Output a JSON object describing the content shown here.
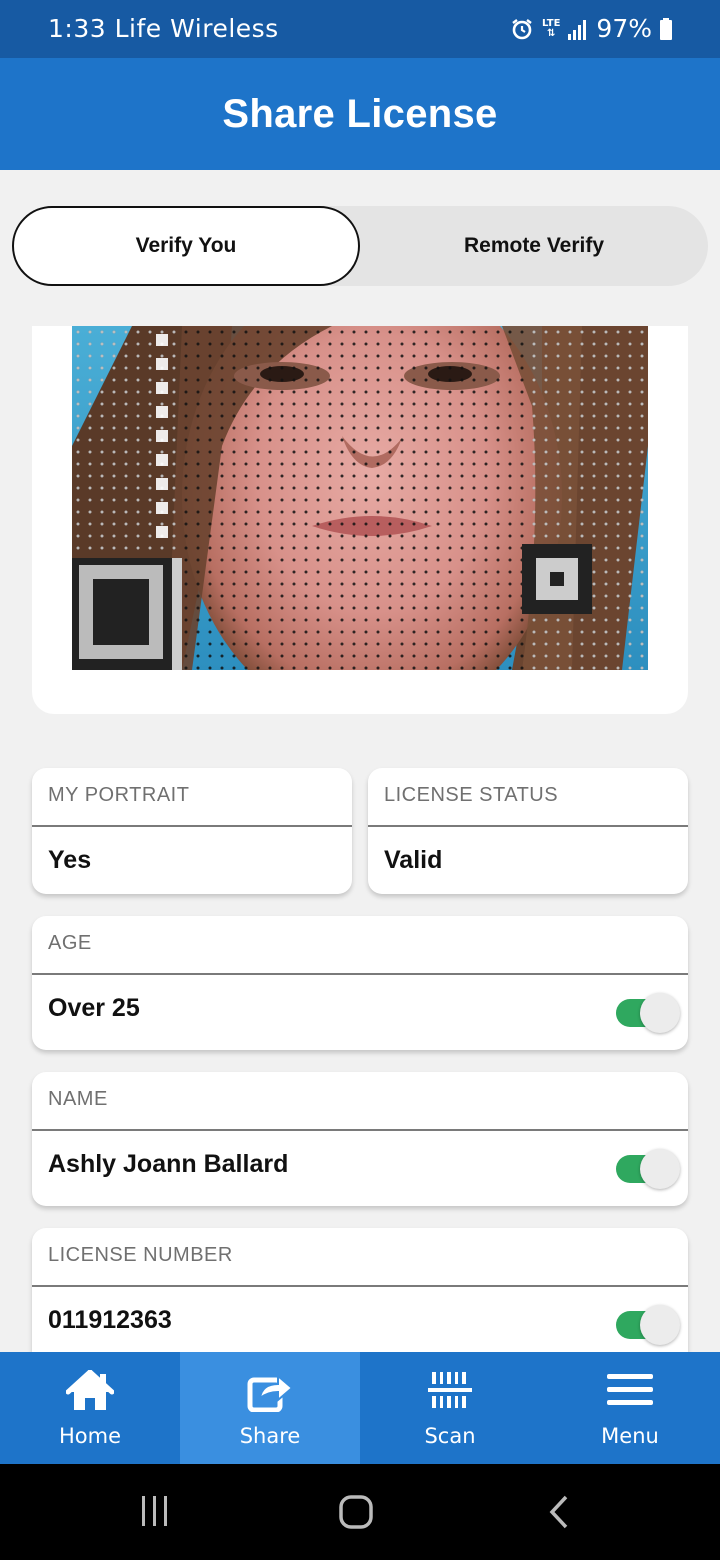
{
  "status_bar": {
    "time": "1:33",
    "carrier": "Life Wireless",
    "network": "LTE",
    "battery": "97%",
    "icons": [
      "alarm-icon",
      "lte-icon",
      "signal-icon",
      "battery-icon"
    ]
  },
  "header": {
    "title": "Share License"
  },
  "segment": {
    "tabs": [
      {
        "label": "Verify You",
        "selected": true
      },
      {
        "label": "Remote Verify",
        "selected": false
      }
    ]
  },
  "fields": {
    "portrait": {
      "label": "MY PORTRAIT",
      "value": "Yes"
    },
    "license_status": {
      "label": "LICENSE STATUS",
      "value": "Valid"
    },
    "age": {
      "label": "AGE",
      "value": "Over 25",
      "shared": true
    },
    "name": {
      "label": "NAME",
      "value": "Ashly Joann Ballard",
      "shared": true
    },
    "license_number": {
      "label": "LICENSE NUMBER",
      "value": "011912363",
      "shared": true
    }
  },
  "bottom_nav": {
    "items": [
      {
        "label": "Home",
        "icon": "home-icon",
        "active": false
      },
      {
        "label": "Share",
        "icon": "share-icon",
        "active": true
      },
      {
        "label": "Scan",
        "icon": "barcode-scan-icon",
        "active": false
      },
      {
        "label": "Menu",
        "icon": "hamburger-menu-icon",
        "active": false
      }
    ]
  },
  "system_nav": {
    "icons": [
      "recent-apps-icon",
      "home-circle-icon",
      "back-icon"
    ]
  },
  "colors": {
    "status_bar": "#175aa3",
    "primary": "#1e74c9",
    "nav_active": "#3a8fe0",
    "toggle_on": "#2fa85f",
    "page_bg": "#f1f1f1"
  }
}
